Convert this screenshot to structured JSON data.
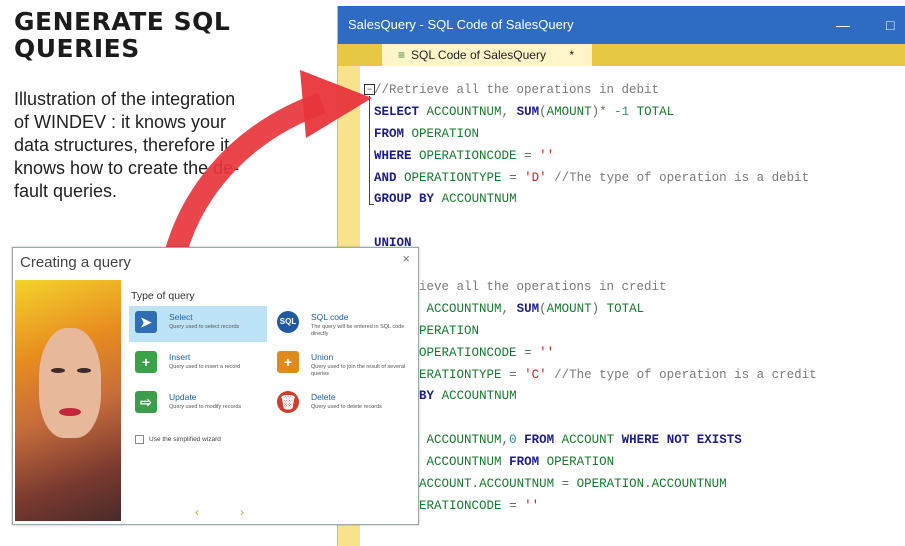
{
  "heading": {
    "line1": "GENERATE SQL",
    "line2": "QUERIES"
  },
  "description": [
    "Illustration of the integration",
    "of WINDEV : it knows your",
    "data structures, therefore it",
    "knows how to create the de-",
    "fault queries."
  ],
  "editor": {
    "window_title": "SalesQuery - SQL Code of SalesQuery",
    "minimize": "—",
    "maximize": "□",
    "tab_label": "SQL Code of SalesQuery",
    "tab_close": "*",
    "fold_marker": "⊟",
    "lines": [
      "//Retrieve all the operations in debit",
      "SELECT ACCOUNTNUM, SUM(AMOUNT)* -1 TOTAL",
      "FROM OPERATION",
      "WHERE OPERATIONCODE = ''",
      "AND OPERATIONTYPE = 'D' //The type of operation is a debit",
      "GROUP BY ACCOUNTNUM",
      "",
      "UNION",
      "",
      "//Retrieve all the operations in credit",
      "SELECT ACCOUNTNUM, SUM(AMOUNT) TOTAL",
      "FROM OPERATION",
      "WHERE OPERATIONCODE = ''",
      "AND OPERATIONTYPE = 'C' //The type of operation is a credit",
      "GROUP BY ACCOUNTNUM",
      "",
      "SELECT ACCOUNTNUM,0 FROM ACCOUNT WHERE NOT EXISTS",
      "SELECT ACCOUNTNUM FROM OPERATION",
      "WHERE ACCOUNT.ACCOUNTNUM = OPERATION.ACCOUNTNUM",
      "AND OPERATIONCODE = ''"
    ]
  },
  "dialog": {
    "title": "Creating a query",
    "close": "×",
    "section_label": "Type of query",
    "options": [
      {
        "label": "Select",
        "sub": "Query used to select records",
        "icon": "cursor-icon",
        "color": "#2f6db5",
        "glyph": "➤"
      },
      {
        "label": "SQL code",
        "sub": "The query will be entered in SQL code directly",
        "icon": "sql-icon",
        "color": "#1f5aa0",
        "glyph": "SQL"
      },
      {
        "label": "Insert",
        "sub": "Query used to insert a record",
        "icon": "plus-icon",
        "color": "#3ba24a",
        "glyph": "+"
      },
      {
        "label": "Union",
        "sub": "Query used to join the result of several queries",
        "icon": "union-icon",
        "color": "#e08a1e",
        "glyph": "+"
      },
      {
        "label": "Update",
        "sub": "Query used to modify records",
        "icon": "update-icon",
        "color": "#3a9e4c",
        "glyph": "⇨"
      },
      {
        "label": "Delete",
        "sub": "Query used to delete records",
        "icon": "trash-icon",
        "color": "#d23a2a",
        "glyph": "🗑"
      }
    ],
    "checkbox_label": "Use the simplified wizard",
    "prev": "‹",
    "next": "›"
  },
  "colors": {
    "arrow": "#e8353b",
    "editor_title": "#2e6cc4",
    "gutter": "#f8e38c"
  }
}
